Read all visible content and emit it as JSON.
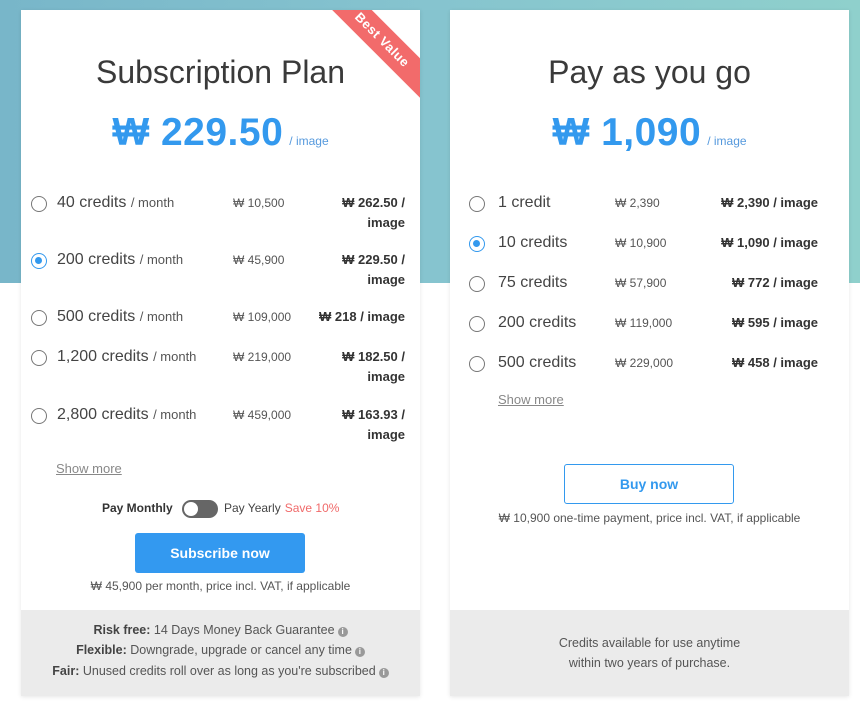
{
  "currency": "₩",
  "subscription": {
    "title": "Subscription Plan",
    "ribbon": "Best Value",
    "price": "₩ 229.50",
    "price_unit": "/ image",
    "options": [
      {
        "credits": "40 credits",
        "period": "/ month",
        "total": "₩ 10,500",
        "per_image_1": "₩ 262.50 /",
        "per_image_2": "image",
        "selected": false
      },
      {
        "credits": "200 credits",
        "period": "/ month",
        "total": "₩ 45,900",
        "per_image_1": "₩ 229.50 /",
        "per_image_2": "image",
        "selected": true
      },
      {
        "credits": "500 credits",
        "period": "/ month",
        "total": "₩ 109,000",
        "per_image_1": "₩ 218 / image",
        "per_image_2": "",
        "selected": false
      },
      {
        "credits": "1,200 credits",
        "period": "/ month",
        "total": "₩ 219,000",
        "per_image_1": "₩ 182.50 /",
        "per_image_2": "image",
        "selected": false
      },
      {
        "credits": "2,800 credits",
        "period": "/ month",
        "total": "₩ 459,000",
        "per_image_1": "₩ 163.93 /",
        "per_image_2": "image",
        "selected": false
      }
    ],
    "show_more": "Show more",
    "toggle": {
      "monthly": "Pay Monthly",
      "yearly": "Pay Yearly",
      "save": "Save 10%",
      "state": "monthly"
    },
    "button": "Subscribe now",
    "note": "₩ 45,900 per month, price incl. VAT, if applicable",
    "footer": [
      {
        "bold": "Risk free:",
        "text": "14 Days Money Back Guarantee"
      },
      {
        "bold": "Flexible:",
        "text": "Downgrade, upgrade or cancel any time"
      },
      {
        "bold": "Fair:",
        "text": "Unused credits roll over as long as you're subscribed"
      }
    ]
  },
  "payg": {
    "title": "Pay as you go",
    "price": "₩ 1,090",
    "price_unit": "/ image",
    "options": [
      {
        "credits": "1 credit",
        "total": "₩ 2,390",
        "per_image": "₩ 2,390 / image",
        "selected": false
      },
      {
        "credits": "10 credits",
        "total": "₩ 10,900",
        "per_image": "₩ 1,090 / image",
        "selected": true
      },
      {
        "credits": "75 credits",
        "total": "₩ 57,900",
        "per_image": "₩ 772 / image",
        "selected": false
      },
      {
        "credits": "200 credits",
        "total": "₩ 119,000",
        "per_image": "₩ 595 / image",
        "selected": false
      },
      {
        "credits": "500 credits",
        "total": "₩ 229,000",
        "per_image": "₩ 458 / image",
        "selected": false
      }
    ],
    "show_more": "Show more",
    "button": "Buy now",
    "note": "₩ 10,900 one-time payment, price incl. VAT, if applicable",
    "footer_1": "Credits available for use anytime",
    "footer_2": "within two years of purchase."
  },
  "colors": {
    "accent": "#3399ee",
    "ribbon": "#f26b6b",
    "save": "#f06a6a"
  }
}
